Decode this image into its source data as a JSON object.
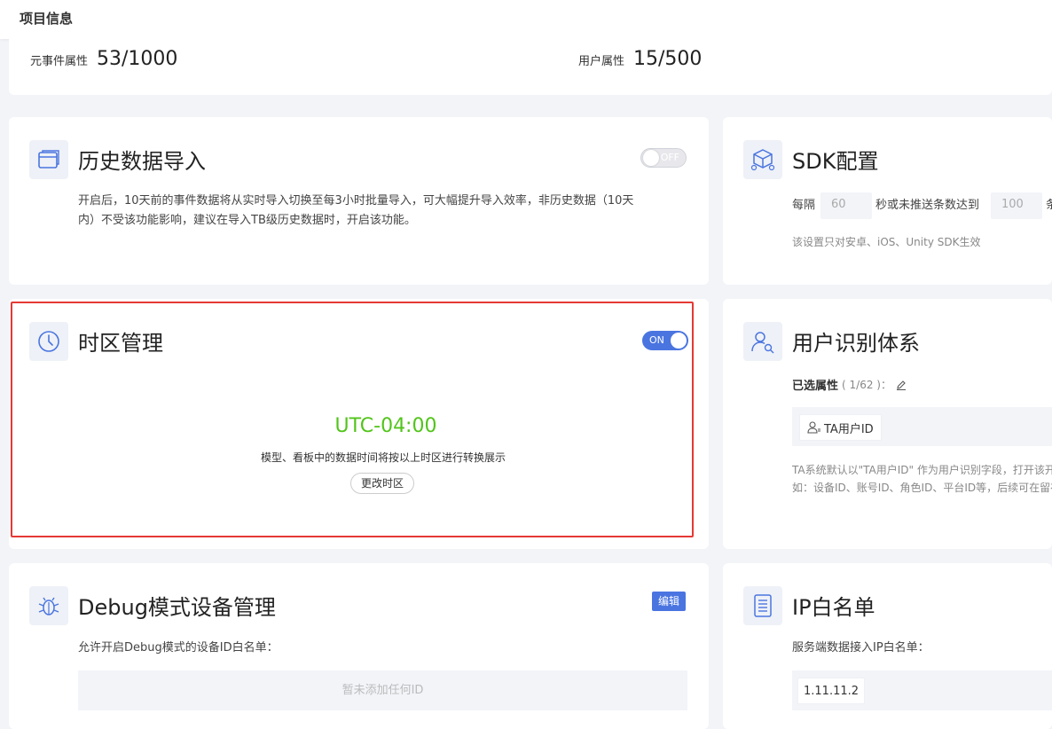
{
  "header": {
    "title": "项目信息"
  },
  "quota": {
    "event_label": "元事件属性",
    "event_value": "53/1000",
    "user_label": "用户属性",
    "user_value": "15/500"
  },
  "history": {
    "title": "历史数据导入",
    "toggle_label": "OFF",
    "desc_line1": "开启后，10天前的事件数据将从实时导入切换至每3小时批量导入，可大幅提升导入效率，非历史数据（10天",
    "desc_line2": "内）不受该功能影响，建议在导入TB级历史数据时，开启该功能。",
    "icon": "window-icon"
  },
  "sdk": {
    "title": "SDK配置",
    "every_label": "每隔",
    "seconds_value": "60",
    "mid_label": "秒或未推送条数达到",
    "count_value": "100",
    "tail_label": "条",
    "note": "该设置只对安卓、iOS、Unity SDK生效",
    "icon": "cube-icon"
  },
  "timezone": {
    "title": "时区管理",
    "toggle_label": "ON",
    "value": "UTC-04:00",
    "desc": "模型、看板中的数据时间将按以上时区进行转换展示",
    "change_button": "更改时区",
    "icon": "clock-icon"
  },
  "identity": {
    "title": "用户识别体系",
    "selected_label": "已选属性",
    "selected_count": "( 1/62 )：",
    "chip_label": "TA用户ID",
    "note_line1": "TA系统默认以\"TA用户ID\" 作为用户识别字段，打开该开关",
    "note_line2": "如：设备ID、账号ID、角色ID、平台ID等，后续可在留存",
    "icon": "user-search-icon"
  },
  "debug": {
    "title": "Debug模式设备管理",
    "edit_label": "编辑",
    "desc": "允许开启Debug模式的设备ID白名单：",
    "empty": "暂未添加任何ID",
    "icon": "bug-icon"
  },
  "ip": {
    "title": "IP白名单",
    "desc": "服务端数据接入IP白名单：",
    "ip_value": "1.11.11.2",
    "icon": "list-icon"
  },
  "colors": {
    "accent": "#4a75e0",
    "success": "#52c41a",
    "highlight": "#e53935"
  }
}
